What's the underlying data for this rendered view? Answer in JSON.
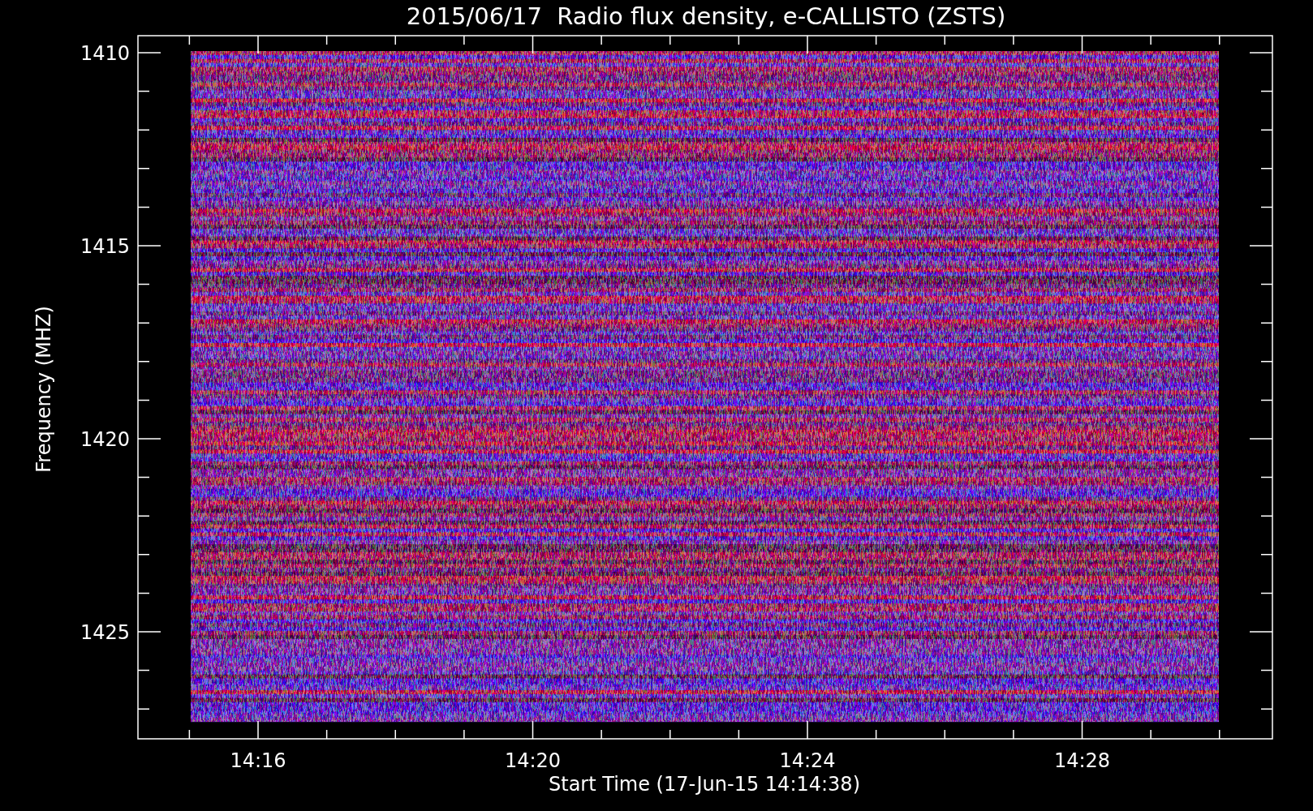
{
  "title": "2015/06/17  Radio flux density, e-CALLISTO (ZSTS)",
  "plot": {
    "y_axis": {
      "label": "Frequency (MHZ)",
      "ticks": [
        "1410",
        "1415",
        "1420",
        "1425"
      ]
    },
    "x_axis": {
      "label": "Start Time (17-Jun-15 14:14:38)",
      "ticks": [
        "14:16",
        "14:20",
        "14:24",
        "14:28"
      ]
    }
  }
}
